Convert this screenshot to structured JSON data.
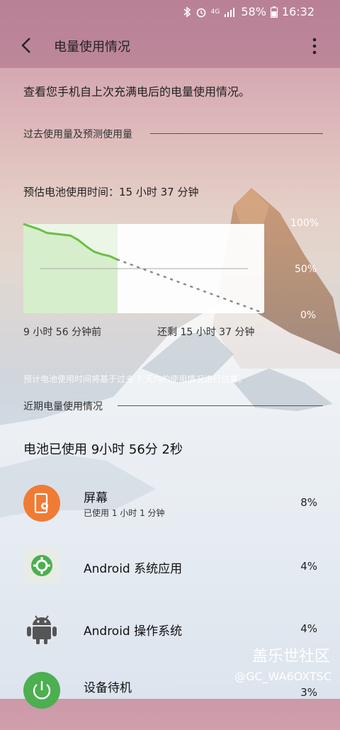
{
  "status_bar": {
    "network_label": "4G",
    "battery": "58%",
    "time": "16:32",
    "icons": [
      "bluetooth-icon",
      "alarm-icon",
      "signal-icon",
      "battery-icon"
    ]
  },
  "app_bar": {
    "title": "电量使用情况",
    "back_icon": "back-arrow-icon",
    "more_icon": "more-vert-icon"
  },
  "description": "查看您手机自上次充满电后的电量使用情况。",
  "sections": {
    "past_usage": "过去使用量及预测使用量",
    "recent_usage": "近期电量使用情况"
  },
  "estimate": "预估电池使用时间：15 小时 37 分钟",
  "chart_data": {
    "type": "line",
    "ylim": [
      0,
      100
    ],
    "y_ticks": [
      "100%",
      "50%",
      "0%"
    ],
    "x_labels": [
      "9 小时 56 分钟前",
      "还剩 15 小时 37 分钟"
    ],
    "series": [
      {
        "kind": "actual",
        "values": [
          100,
          97,
          94,
          90,
          89,
          88,
          87,
          82,
          75,
          69,
          66,
          64,
          60
        ],
        "color": "#6bbf45"
      },
      {
        "kind": "predicted",
        "values": [
          60,
          0
        ],
        "color": "#8a8a8a"
      }
    ],
    "grid": true
  },
  "prediction_note": "预计电池使用时间将基于过去 7 天内的使用情况进行估算。",
  "battery_used": "电池已使用 9小时 56分 2秒",
  "apps": [
    {
      "name": "屏幕",
      "sub": "已使用 1 小时 1 分钟",
      "pct": "8%",
      "icon": "screen-icon",
      "color": "#f07b35"
    },
    {
      "name": "Android 系统应用",
      "sub": "",
      "pct": "4%",
      "icon": "gear-icon",
      "color": "#4caf50"
    },
    {
      "name": "Android 操作系统",
      "sub": "",
      "pct": "4%",
      "icon": "android-icon",
      "color": "#555555"
    },
    {
      "name": "设备待机",
      "sub": "",
      "pct": "3%",
      "icon": "power-icon",
      "color": "#4caf50"
    }
  ],
  "watermark": {
    "line1": "盖乐世社区",
    "line2": "@GC_WA6OXTSC"
  }
}
